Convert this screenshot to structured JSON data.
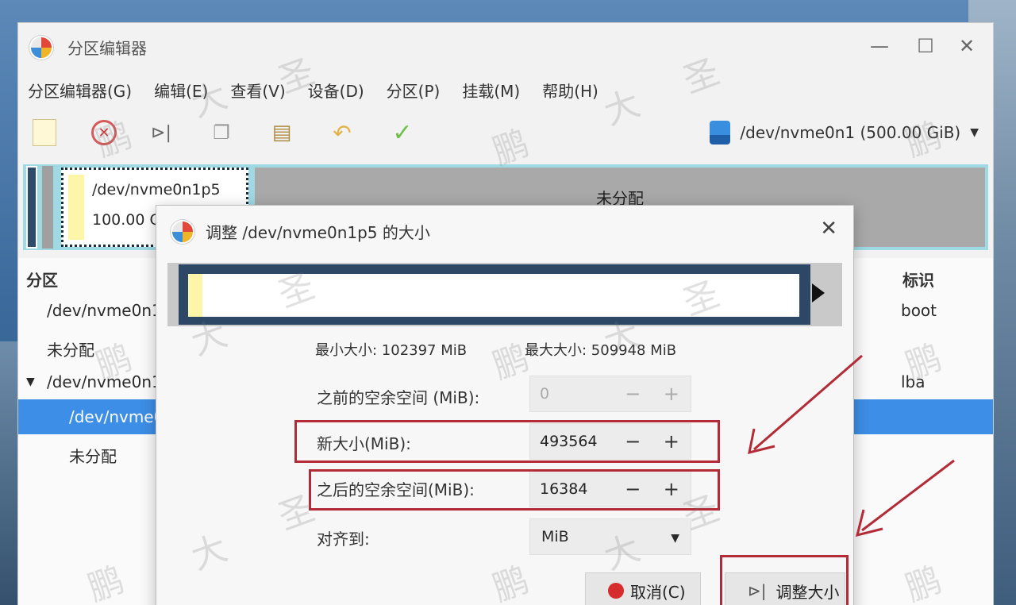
{
  "window": {
    "title": "分区编辑器",
    "controls": {
      "minimize": "—",
      "maximize": "☐",
      "close": "✕"
    }
  },
  "menu": [
    "分区编辑器(G)",
    "编辑(E)",
    "查看(V)",
    "设备(D)",
    "分区(P)",
    "挂载(M)",
    "帮助(H)"
  ],
  "toolbar": {
    "icons": [
      "new-partition-icon",
      "delete-icon",
      "resize-move-icon",
      "copy-icon",
      "paste-icon",
      "undo-icon",
      "apply-icon"
    ],
    "device": "/dev/nvme0n1 (500.00 GiB)"
  },
  "disk_map": {
    "partition_name": "/dev/nvme0n1p5",
    "partition_size": "100.00 G",
    "unallocated": "未分配"
  },
  "partition_list": {
    "headers": {
      "partition": "分区",
      "flags": "标识"
    },
    "rows": [
      {
        "name": "/dev/nvme0n1",
        "flag": "boot"
      },
      {
        "name": "未分配",
        "flag": ""
      },
      {
        "name": "/dev/nvme0n1",
        "flag": "lba"
      },
      {
        "name": "/dev/nvme0",
        "flag": ""
      },
      {
        "name": "未分配",
        "flag": ""
      }
    ]
  },
  "dialog": {
    "title": "调整 /dev/nvme0n1p5 的大小",
    "close": "✕",
    "min_size": "最小大小: 102397 MiB",
    "max_size": "最大大小: 509948 MiB",
    "free_before": {
      "label": "之前的空余空间 (MiB):",
      "value": "0"
    },
    "new_size": {
      "label": "新大小(MiB):",
      "value": "493564"
    },
    "free_after": {
      "label": "之后的空余空间(MiB):",
      "value": "16384"
    },
    "align": {
      "label": "对齐到:",
      "value": "MiB"
    },
    "spin": {
      "minus": "−",
      "plus": "+"
    },
    "cancel": "取消(C)",
    "resize": "调整大小",
    "resize_glyph": "⊳|"
  },
  "watermark": [
    "鹏",
    "大",
    "圣"
  ]
}
